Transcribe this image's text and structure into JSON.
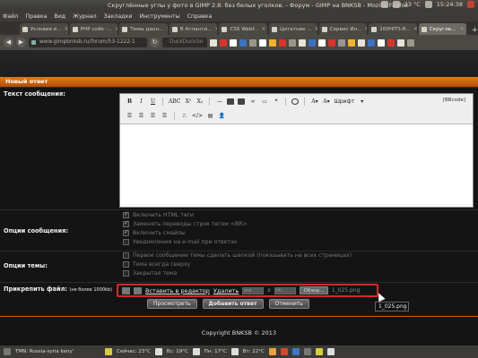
{
  "window": {
    "title": "Скруглённые углы у фото в GIMP 2.8. без белых уголков. - Форум - GIMP на BNKSB - Mozilla Firefox",
    "temp": "23 °C",
    "time": "15:24:38"
  },
  "menubar": [
    "Файл",
    "Правка",
    "Вид",
    "Журнал",
    "Закладки",
    "Инструменты",
    "Справка"
  ],
  "tabs": [
    {
      "label": "Условия и...",
      "active": false
    },
    {
      "label": "PHP code -...",
      "active": false
    },
    {
      "label": "Темы данн...",
      "active": false
    },
    {
      "label": "В Атланти...",
      "active": false
    },
    {
      "label": "CSS Webf...",
      "active": false
    },
    {
      "label": "Цитатник ...",
      "active": false
    },
    {
      "label": "Сервис Ин...",
      "active": false
    },
    {
      "label": "100HITS-R...",
      "active": false
    },
    {
      "label": "Скругле...",
      "active": true
    }
  ],
  "navbar": {
    "url": "www.gimpbnksb.ru/forum/53-1222-1",
    "search_placeholder": "DuckDuckGo"
  },
  "page": {
    "header": "Новый ответ",
    "message_label": "Текст сообщения:",
    "bbcode": "[BBcode]",
    "font_select": "Шрифт",
    "msg_options_label": "Опции сообщения:",
    "msg_options": [
      {
        "text": "Включить HTML теги",
        "checked": true
      },
      {
        "text": "Заменять переводы строк тегом <BR>",
        "checked": true
      },
      {
        "text": "Включить смайлы",
        "checked": true
      },
      {
        "text": "Уведомления на e-mail при ответах",
        "checked": false
      }
    ],
    "topic_options_label": "Опции темы:",
    "topic_options": [
      {
        "text": "Первое сообщение темы сделать шапкой (показывать на всех страницах)",
        "checked": false
      },
      {
        "text": "Тема всегда сверху",
        "checked": false
      },
      {
        "text": "Закрытая тема",
        "checked": false
      }
    ],
    "attach_label": "Прикрепить файл:",
    "attach_note": "(не более 1000kb)",
    "insert_link": "Вставить в редактор",
    "delete_link": "Удалить",
    "width_placeholder": "ww",
    "height_placeholder": "hh",
    "times": "x",
    "browse": "Обзор...",
    "filename": "1_025.png",
    "buttons": {
      "preview": "Просмотреть",
      "submit": "Добавить ответ",
      "cancel": "Отменить"
    },
    "footer": "Copyright BNKSB © 2013",
    "tooltip": "1_025.png"
  },
  "bottombar": {
    "tmn": "TMN: Russia-syria keny'",
    "weather1": "Сейчас: 23°C",
    "weather2": "Вс: 19°C",
    "weather3": "Пн: 17°C",
    "weather4": "Вт: 22°C"
  }
}
